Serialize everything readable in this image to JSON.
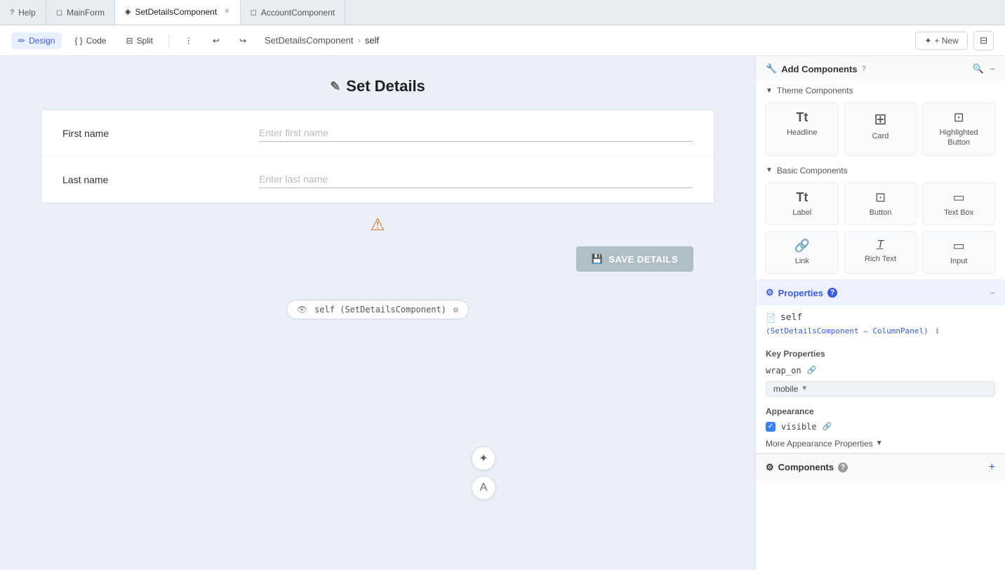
{
  "tabs": [
    {
      "id": "help",
      "label": "Help",
      "icon": "?",
      "active": false,
      "closeable": false
    },
    {
      "id": "mainform",
      "label": "MainForm",
      "icon": "◻",
      "active": false,
      "closeable": false
    },
    {
      "id": "setdetails",
      "label": "SetDetailsComponent",
      "icon": "◈",
      "active": true,
      "closeable": true
    },
    {
      "id": "accountcomponent",
      "label": "AccountComponent",
      "icon": "◻",
      "active": false,
      "closeable": false
    }
  ],
  "toolbar": {
    "design_label": "Design",
    "code_label": "Code",
    "split_label": "Split",
    "breadcrumb_parent": "SetDetailsComponent",
    "breadcrumb_child": "self",
    "new_label": "+ New"
  },
  "canvas": {
    "page_title": "Set Details",
    "form": {
      "rows": [
        {
          "label": "First name",
          "placeholder": "Enter first name"
        },
        {
          "label": "Last name",
          "placeholder": "Enter last name"
        }
      ],
      "save_button_label": "SAVE DETAILS"
    },
    "self_label": "self (SetDetailsComponent)"
  },
  "add_components": {
    "title": "Add Components",
    "section_label": "Theme Components",
    "theme_items": [
      {
        "id": "headline",
        "icon": "T̲T̲",
        "label": "Headline"
      },
      {
        "id": "card",
        "icon": "⊞",
        "label": "Card"
      },
      {
        "id": "highlighted-button",
        "icon": "⊡",
        "label": "Highlighted Button"
      }
    ],
    "basic_label": "Basic Components",
    "basic_items": [
      {
        "id": "label",
        "icon": "Tt",
        "label": "Label"
      },
      {
        "id": "button",
        "icon": "⊡",
        "label": "Button"
      },
      {
        "id": "text-box",
        "icon": "▭",
        "label": "Text Box"
      },
      {
        "id": "link",
        "icon": "🔗",
        "label": "Link"
      },
      {
        "id": "rich-text",
        "icon": "T̲T̲",
        "label": "Rich Text"
      },
      {
        "id": "input",
        "icon": "▭",
        "label": "Input"
      }
    ]
  },
  "properties": {
    "title": "Properties",
    "self_value": "self",
    "type_text": "(SetDetailsComponent – ColumnPanel)",
    "key_props_label": "Key Properties",
    "wrap_on_key": "wrap_on",
    "wrap_on_value": "mobile",
    "appearance_label": "Appearance",
    "visible_label": "visible",
    "more_appearance_label": "More Appearance Properties"
  },
  "components_bottom": {
    "title": "Components",
    "plus_icon": "+"
  }
}
